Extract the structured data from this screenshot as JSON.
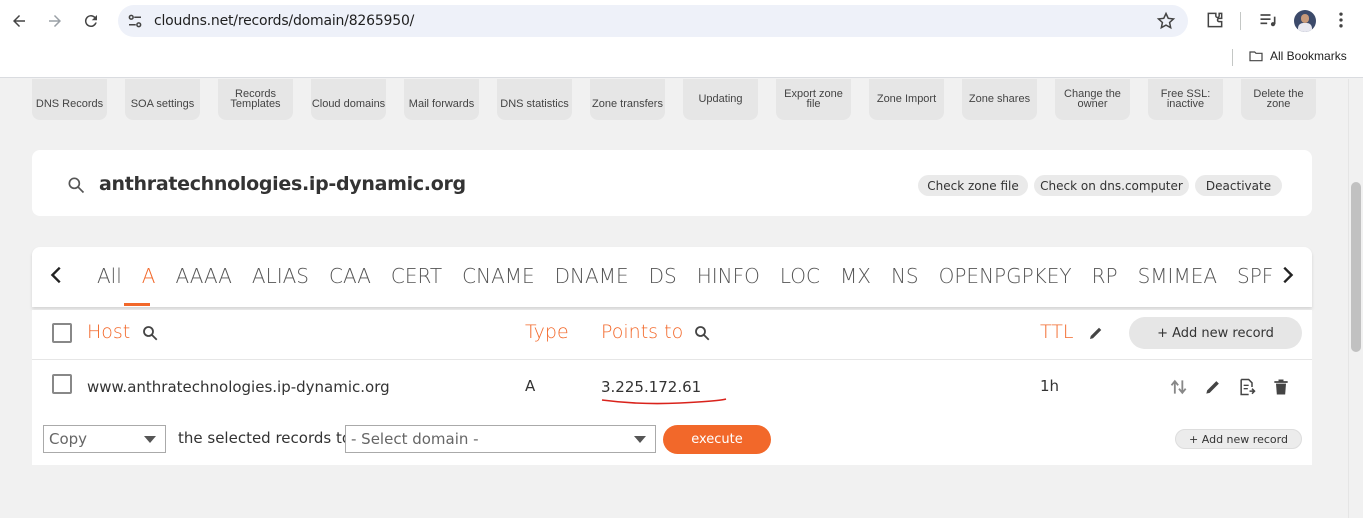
{
  "browser": {
    "url": "cloudns.net/records/domain/8265950/",
    "bookmarks_label": "All Bookmarks"
  },
  "toolbar": {
    "tools": [
      {
        "label": "DNS Records"
      },
      {
        "label": "SOA settings"
      },
      {
        "label": "Records Templates"
      },
      {
        "label": "Cloud domains"
      },
      {
        "label": "Mail forwards"
      },
      {
        "label": "DNS statistics"
      },
      {
        "label": "Zone transfers"
      },
      {
        "label": "Updating"
      },
      {
        "label": "Export zone file"
      },
      {
        "label": "Zone Import"
      },
      {
        "label": "Zone shares"
      },
      {
        "label": "Change the owner"
      },
      {
        "label": "Free SSL: inactive"
      },
      {
        "label": "Delete the zone"
      }
    ]
  },
  "domain": {
    "name": "anthratechnologies.ip-dynamic.org",
    "actions": [
      "Check zone file",
      "Check on dns.computer",
      "Deactivate"
    ]
  },
  "tabs": {
    "items": [
      "All",
      "A",
      "AAAA",
      "ALIAS",
      "CAA",
      "CERT",
      "CNAME",
      "DNAME",
      "DS",
      "HINFO",
      "LOC",
      "MX",
      "NS",
      "OPENPGPKEY",
      "RP",
      "SMIMEA",
      "SPF"
    ],
    "active": "A"
  },
  "table": {
    "headers": {
      "host": "Host",
      "type": "Type",
      "points_to": "Points to",
      "ttl": "TTL"
    },
    "add_record_label": "+ Add new record",
    "rows": [
      {
        "host": "www.anthratechnologies.ip-dynamic.org",
        "type": "A",
        "points_to": "3.225.172.61",
        "ttl": "1h"
      }
    ]
  },
  "bulk": {
    "action_value": "Copy",
    "middle_text": "the selected records to",
    "domain_placeholder": "- Select domain -",
    "execute_label": "execute",
    "add_record_label": "+ Add new record"
  },
  "colors": {
    "accent": "#f2682a",
    "underline_red": "#d9231c"
  }
}
